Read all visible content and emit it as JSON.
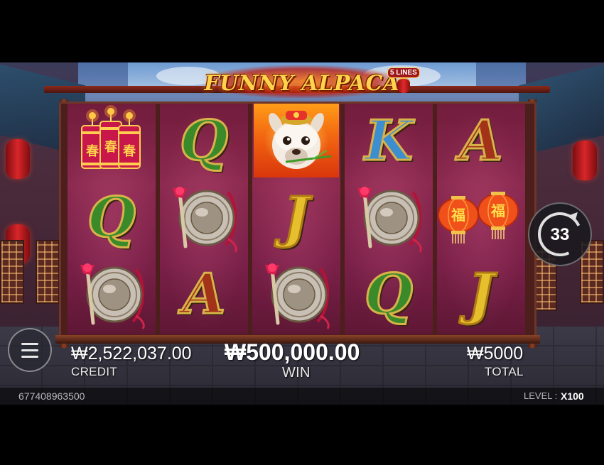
{
  "game": {
    "title": "FUNNY ALPACA",
    "lines_badge": "5 LINES",
    "reels": [
      [
        "firecracker",
        "q",
        "gong"
      ],
      [
        "q",
        "gong",
        "a"
      ],
      [
        "alpaca",
        "j",
        "gong"
      ],
      [
        "k",
        "gong",
        "q"
      ],
      [
        "a",
        "lantern",
        "j"
      ]
    ],
    "letters": {
      "q": "Q",
      "k": "K",
      "a": "A",
      "j": "J"
    },
    "firecracker_char": "春",
    "lantern_char": "福"
  },
  "hud": {
    "credit_value": "₩2,522,037.00",
    "credit_label": "CREDIT",
    "win_value": "₩500,000.00",
    "win_label": "WIN",
    "total_value": "₩5000",
    "total_label": "TOTAL",
    "auto_spin_count": "33",
    "account_id": "677408963500",
    "level_label": "LEVEL :",
    "level_value": "X100"
  },
  "icons": {
    "menu": "hamburger-menu-icon",
    "spin": "auto-spin-icon"
  },
  "colors": {
    "reel_bg": "#7a2048",
    "accent_gold": "#ffd34a",
    "q_green": "#3a8a2a",
    "k_blue": "#3d8ed0",
    "a_red": "#a23318",
    "j_yellow": "#e6bf2c"
  }
}
